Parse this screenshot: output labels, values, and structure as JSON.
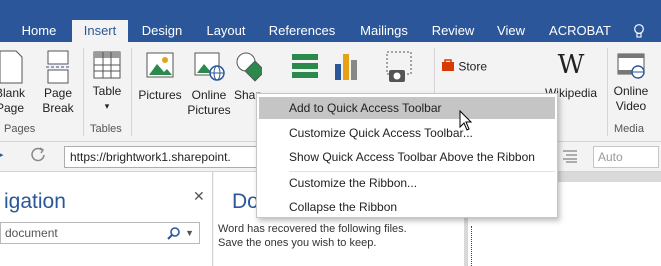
{
  "tabs": [
    {
      "label": "Home",
      "active": false
    },
    {
      "label": "Insert",
      "active": true
    },
    {
      "label": "Design",
      "active": false
    },
    {
      "label": "Layout",
      "active": false
    },
    {
      "label": "References",
      "active": false
    },
    {
      "label": "Mailings",
      "active": false
    },
    {
      "label": "Review",
      "active": false
    },
    {
      "label": "View",
      "active": false
    },
    {
      "label": "ACROBAT",
      "active": false
    }
  ],
  "help_icon": "lightbulb-icon",
  "ribbon": {
    "pages": {
      "blank_line1": "Blank",
      "blank_line2": "Page",
      "pagebreak_line1": "Page",
      "pagebreak_line2": "Break",
      "group": "Pages"
    },
    "tables": {
      "table": "Table",
      "caret": "▾",
      "group": "Tables"
    },
    "illustrations": {
      "pictures": "Pictures",
      "online_line1": "Online",
      "online_line2": "Pictures",
      "shapes": "Shapes",
      "smartart": "SmartArt",
      "chart": "Chart",
      "screenshot": "Screenshot"
    },
    "addins": {
      "store": "Store",
      "wikipedia": "Wikipedia"
    },
    "media": {
      "video_line1": "Online",
      "video_line2": "Video",
      "group": "Media"
    }
  },
  "toolbar": {
    "url": "https://brightwork1.sharepoint.",
    "font_size_placeholder": "Auto"
  },
  "navigation": {
    "title": "igation",
    "search_placeholder": "document"
  },
  "recovery": {
    "title": "Do",
    "text_line1": "Word has recovered the following files.",
    "text_line2": "Save the ones you wish to keep."
  },
  "context_menu": {
    "items": [
      {
        "label": "Add to Quick Access Toolbar",
        "highlighted": true
      },
      {
        "label": "Customize Quick Access Toolbar...",
        "highlighted": false
      },
      {
        "label": "Show Quick Access Toolbar Above the Ribbon",
        "highlighted": false
      },
      {
        "label": "Customize the Ribbon...",
        "highlighted": false
      },
      {
        "label": "Collapse the Ribbon",
        "highlighted": false
      }
    ]
  },
  "colors": {
    "accent": "#2b579a",
    "menu_highlight": "#c5c5c5",
    "store_red": "#d83b01"
  }
}
